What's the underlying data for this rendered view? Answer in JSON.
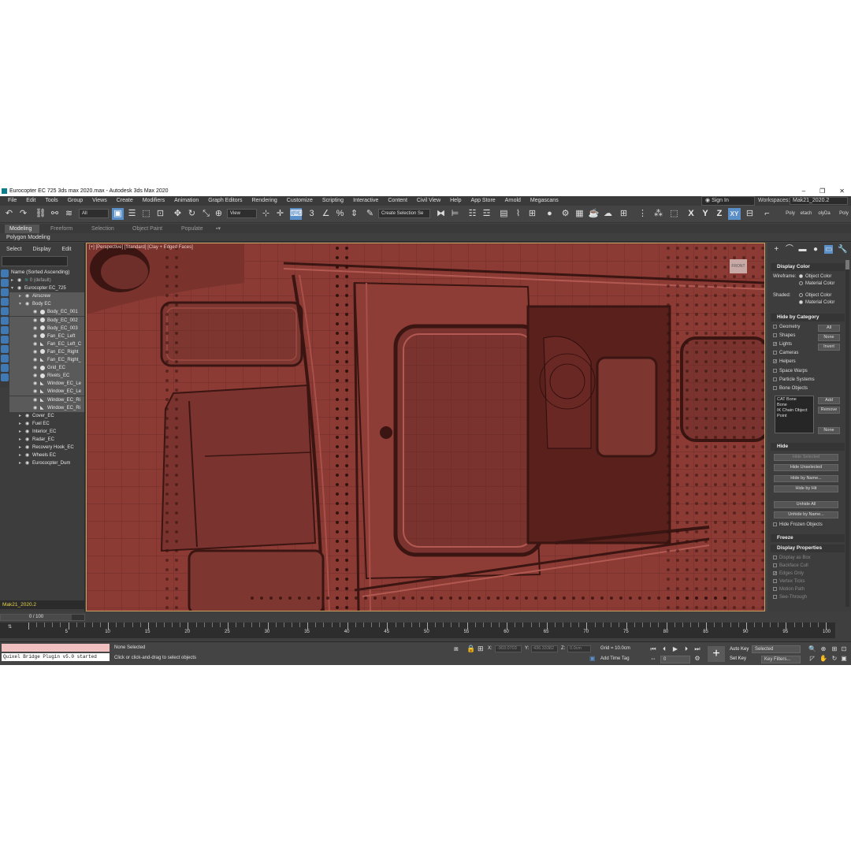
{
  "window": {
    "title": "Eurocopter EC 725 3ds max 2020.max - Autodesk 3ds Max 2020",
    "minimize": "‒",
    "restore": "❐",
    "close": "✕"
  },
  "menu": [
    "File",
    "Edit",
    "Tools",
    "Group",
    "Views",
    "Create",
    "Modifiers",
    "Animation",
    "Graph Editors",
    "Rendering",
    "Customize",
    "Scripting",
    "Interactive",
    "Content",
    "Civil View",
    "Help",
    "App Store",
    "Arnold",
    "Megascans"
  ],
  "signin": "Sign In",
  "workspaces": {
    "label": "Workspaces:",
    "value": "Mak21_2020.2"
  },
  "toolbar": {
    "selection_filter": "All",
    "ref_coord": "View",
    "named_selection": "Create Selection Se",
    "axes": [
      "X",
      "Y",
      "Z",
      "XY"
    ],
    "right_labels": [
      "Poly",
      "etach",
      "olyDa",
      "Poly"
    ]
  },
  "ribbon": {
    "tabs": [
      "Modeling",
      "Freeform",
      "Selection",
      "Object Paint",
      "Populate"
    ],
    "sub_label": "Polygon Modeling"
  },
  "scene_explorer": {
    "menu": [
      "Select",
      "Display",
      "Edit"
    ],
    "header": "Name (Sorted Ascending)",
    "rows": [
      {
        "label": "0 (default)",
        "indent": 0
      },
      {
        "label": "Eurocopter EC_725",
        "indent": 0
      },
      {
        "label": "Airscrew",
        "indent": 1
      },
      {
        "label": "Body EC",
        "indent": 1
      },
      {
        "label": "Body_EC_001",
        "indent": 2
      },
      {
        "label": "Body_EC_002",
        "indent": 2
      },
      {
        "label": "Body_EC_003",
        "indent": 2
      },
      {
        "label": "Fan_EC_Left",
        "indent": 2
      },
      {
        "label": "Fan_EC_Left_C",
        "indent": 2
      },
      {
        "label": "Fan_EC_Right",
        "indent": 2
      },
      {
        "label": "Fan_EC_Right_",
        "indent": 2
      },
      {
        "label": "Grid_EC",
        "indent": 2
      },
      {
        "label": "Rivets_EC",
        "indent": 2
      },
      {
        "label": "Window_EC_Le",
        "indent": 2
      },
      {
        "label": "Window_EC_Le",
        "indent": 2
      },
      {
        "label": "Window_EC_Ri",
        "indent": 2
      },
      {
        "label": "Window_EC_Ri",
        "indent": 2
      },
      {
        "label": "Cover_EC",
        "indent": 1
      },
      {
        "label": "Fuel EC",
        "indent": 1
      },
      {
        "label": "Interior_EC",
        "indent": 1
      },
      {
        "label": "Radar_EC",
        "indent": 1
      },
      {
        "label": "Recovery Hook_EC",
        "indent": 1
      },
      {
        "label": "Wheels EC",
        "indent": 1
      },
      {
        "label": "Eurococpter_Dum",
        "indent": 1
      }
    ],
    "workspace_bottom": "Mak21_2020.2"
  },
  "viewport": {
    "label": "[+] [Perspective] [Standard] [Clay + Edged Faces]",
    "viewcube": "FRONT"
  },
  "command_panel": {
    "display_color": {
      "title": "Display Color",
      "wireframe_label": "Wireframe:",
      "shaded_label": "Shaded:",
      "object_color": "Object Color",
      "material_color": "Material Color"
    },
    "hide_by_category": {
      "title": "Hide by Category",
      "items": [
        "Geometry",
        "Shapes",
        "Lights",
        "Cameras",
        "Helpers",
        "Space Warps",
        "Particle Systems",
        "Bone Objects"
      ],
      "checked": [
        false,
        false,
        true,
        false,
        true,
        false,
        false,
        false
      ],
      "buttons": [
        "All",
        "None",
        "Invert"
      ],
      "list": [
        "CAT Bone",
        "Bone",
        "IK Chain Object",
        "Point"
      ],
      "list_buttons": [
        "Add",
        "Remove",
        "None"
      ]
    },
    "hide": {
      "title": "Hide",
      "buttons": [
        "Hide Selected",
        "Hide Unselected",
        "Hide by Name...",
        "Hide by Hit",
        "Unhide All",
        "Unhide by Name..."
      ],
      "hide_frozen": "Hide Frozen Objects"
    },
    "freeze_title": "Freeze",
    "display_properties": {
      "title": "Display Properties",
      "items": [
        "Display as Box",
        "Backface Cull",
        "Edges Only",
        "Vertex Ticks",
        "Motion Path",
        "See-Through"
      ]
    }
  },
  "timeline": {
    "slider": "0 / 100",
    "ticks": [
      "5",
      "10",
      "15",
      "20",
      "25",
      "30",
      "35",
      "40",
      "45",
      "50",
      "55",
      "60",
      "65",
      "70",
      "75",
      "80",
      "85",
      "90",
      "95",
      "100"
    ]
  },
  "status": {
    "quixel": "Quixel Bridge Plugin v5.0 started",
    "none_selected": "None Selected",
    "prompt": "Click or click-and-drag to select objects",
    "x_label": "X:",
    "x_value": "-903.0703",
    "y_label": "Y:",
    "y_value": "436.33382",
    "z_label": "Z:",
    "z_value": "0.0cm",
    "grid": "Grid = 10.0cm",
    "add_time_tag": "Add Time Tag",
    "auto_key": "Auto Key",
    "set_key": "Set Key",
    "selected": "Selected",
    "key_filters": "Key Filters...",
    "frame": "0"
  }
}
